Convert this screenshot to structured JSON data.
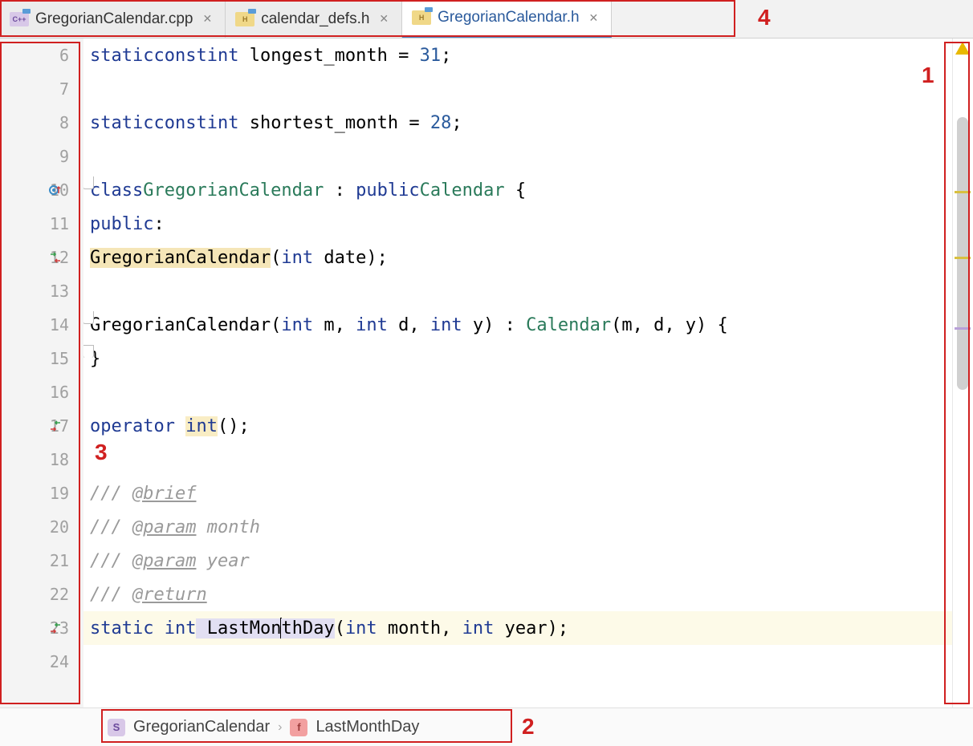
{
  "tabs": [
    {
      "label": "GregorianCalendar.cpp",
      "filetype": "cpp",
      "active": false
    },
    {
      "label": "calendar_defs.h",
      "filetype": "h",
      "active": false
    },
    {
      "label": "GregorianCalendar.h",
      "filetype": "h",
      "active": true
    }
  ],
  "gutter": {
    "start": 6,
    "end": 24
  },
  "code": {
    "l6": {
      "kw1": "static",
      "kw2": "const",
      "kw3": "int",
      "name": " longest_month ",
      "eq": "=",
      "sp": " ",
      "val": "31",
      "semi": ";"
    },
    "l8": {
      "kw1": "static",
      "kw2": "const",
      "kw3": "int",
      "name": " shortest_month ",
      "eq": "=",
      "sp": " ",
      "val": "28",
      "semi": ";"
    },
    "l10": {
      "kw": "class",
      "cls": "GregorianCalendar",
      "sep": " : ",
      "kw2": "public",
      "cls2": "Calendar",
      "brace": " {"
    },
    "l11": {
      "kw": "public",
      "colon": ":"
    },
    "l12": {
      "ctor": "GregorianCalendar",
      "open": "(",
      "kw": "int",
      "param": " date)",
      "semi": ";"
    },
    "l14": {
      "ctor": "GregorianCalendar",
      "open": "(",
      "kw1": "int",
      "p1": " m, ",
      "kw2": "int",
      "p2": " d, ",
      "kw3": "int",
      "p3": " y) : ",
      "base": "Calendar",
      "args": "(m, d, y) {"
    },
    "l15": {
      "close": "}"
    },
    "l17": {
      "kw": "operator",
      "sp": " ",
      "type": "int",
      "parens": "()",
      "semi": ";"
    },
    "l19": {
      "slashes": "/// ",
      "tag": "@brief"
    },
    "l20": {
      "slashes": "/// ",
      "tag": "@param",
      "text": " month"
    },
    "l21": {
      "slashes": "/// ",
      "tag": "@param",
      "text": " year"
    },
    "l22": {
      "slashes": "/// ",
      "tag": "@return"
    },
    "l23": {
      "kw1": "static",
      "sp": " ",
      "kw2": "int",
      "fn_pre": " LastMon",
      "fn_post": "thDay",
      "open": "(",
      "kw3": "int",
      "p1": " month, ",
      "kw4": "int",
      "p2": " year)",
      "semi": ";"
    }
  },
  "breadcrumb": {
    "item1": "GregorianCalendar",
    "item2": "LastMonthDay",
    "sep": "›"
  },
  "annotations": {
    "n1": "1",
    "n2": "2",
    "n3": "3",
    "n4": "4"
  }
}
